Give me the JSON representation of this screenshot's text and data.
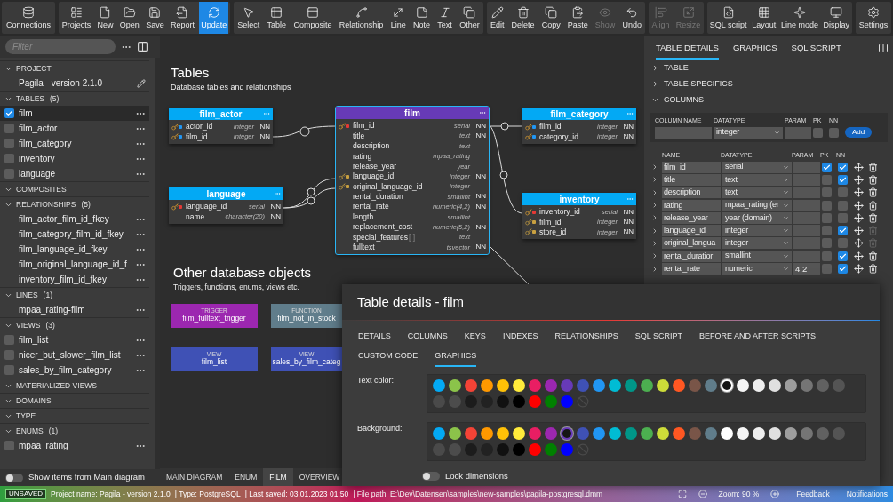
{
  "toolbar": [
    {
      "buttons": [
        {
          "label": "Connections",
          "selected": false,
          "disabled": false
        }
      ]
    },
    {
      "buttons": [
        {
          "label": "Projects",
          "selected": false,
          "disabled": false
        },
        {
          "label": "New",
          "selected": false,
          "disabled": false
        },
        {
          "label": "Open",
          "selected": false,
          "disabled": false
        },
        {
          "label": "Save",
          "selected": false,
          "disabled": false
        },
        {
          "label": "Report",
          "selected": false,
          "disabled": false
        },
        {
          "label": "Update",
          "selected": true,
          "disabled": false
        }
      ]
    },
    {
      "buttons": [
        {
          "label": "Select",
          "selected": false,
          "disabled": false
        },
        {
          "label": "Table",
          "selected": false,
          "disabled": false
        },
        {
          "label": "Composite",
          "selected": false,
          "disabled": false
        },
        {
          "label": "Relationship",
          "selected": false,
          "disabled": false
        },
        {
          "label": "Line",
          "selected": false,
          "disabled": false
        },
        {
          "label": "Note",
          "selected": false,
          "disabled": false
        },
        {
          "label": "Text",
          "selected": false,
          "disabled": false
        },
        {
          "label": "Other",
          "selected": false,
          "disabled": false
        }
      ]
    },
    {
      "buttons": [
        {
          "label": "Edit",
          "selected": false,
          "disabled": false
        },
        {
          "label": "Delete",
          "selected": false,
          "disabled": false
        },
        {
          "label": "Copy",
          "selected": false,
          "disabled": false
        },
        {
          "label": "Paste",
          "selected": false,
          "disabled": false
        },
        {
          "label": "Show",
          "selected": false,
          "disabled": true
        },
        {
          "label": "Undo",
          "selected": false,
          "disabled": false
        }
      ]
    },
    {
      "buttons": [
        {
          "label": "Align",
          "selected": false,
          "disabled": true
        },
        {
          "label": "Resize",
          "selected": false,
          "disabled": true
        }
      ]
    },
    {
      "buttons": [
        {
          "label": "SQL script",
          "selected": false,
          "disabled": false
        },
        {
          "label": "Layout",
          "selected": false,
          "disabled": false
        },
        {
          "label": "Line mode",
          "selected": false,
          "disabled": false
        },
        {
          "label": "Display",
          "selected": false,
          "disabled": false
        }
      ]
    },
    {
      "buttons": [
        {
          "label": "Settings",
          "selected": false,
          "disabled": false
        }
      ]
    }
  ],
  "sidebar": {
    "filter": {
      "placeholder": "Filter"
    },
    "sections": [
      {
        "title": "PROJECT",
        "expanded": true,
        "children": [
          {
            "label": "Pagila - version 2.1.0",
            "kind": "project",
            "selected": false
          }
        ]
      },
      {
        "title": "TABLES",
        "count": "(5)",
        "expanded": true,
        "children": [
          {
            "label": "film",
            "kind": "check",
            "checked": true,
            "selected": true
          },
          {
            "label": "film_actor",
            "kind": "check",
            "checked": false,
            "selected": false
          },
          {
            "label": "film_category",
            "kind": "check",
            "checked": false,
            "selected": false
          },
          {
            "label": "inventory",
            "kind": "check",
            "checked": false,
            "selected": false
          },
          {
            "label": "language",
            "kind": "check",
            "checked": false,
            "selected": false
          }
        ]
      },
      {
        "title": "COMPOSITES",
        "expanded": true
      },
      {
        "title": "RELATIONSHIPS",
        "count": "(5)",
        "expanded": true,
        "children": [
          {
            "label": "film_actor_film_id_fkey",
            "kind": "plain",
            "selected": false
          },
          {
            "label": "film_category_film_id_fkey",
            "kind": "plain",
            "selected": false
          },
          {
            "label": "film_language_id_fkey",
            "kind": "plain",
            "selected": false
          },
          {
            "label": "film_original_language_id_f",
            "kind": "plain",
            "selected": false
          },
          {
            "label": "inventory_film_id_fkey",
            "kind": "plain",
            "selected": false
          }
        ]
      },
      {
        "title": "LINES",
        "count": "(1)",
        "expanded": true,
        "children": [
          {
            "label": "mpaa_rating-film",
            "kind": "plain",
            "selected": false
          }
        ]
      },
      {
        "title": "VIEWS",
        "count": "(3)",
        "expanded": true,
        "children": [
          {
            "label": "film_list",
            "kind": "check",
            "checked": false,
            "selected": false
          },
          {
            "label": "nicer_but_slower_film_list",
            "kind": "check",
            "checked": false,
            "selected": false
          },
          {
            "label": "sales_by_film_category",
            "kind": "check",
            "checked": false,
            "selected": false
          }
        ]
      },
      {
        "title": "MATERIALIZED VIEWS",
        "expanded": true
      },
      {
        "title": "DOMAINS",
        "expanded": true
      },
      {
        "title": "TYPE",
        "expanded": true
      },
      {
        "title": "ENUMS",
        "count": "(1)",
        "expanded": true,
        "children": [
          {
            "label": "mpaa_rating",
            "kind": "check",
            "checked": false,
            "selected": false
          }
        ]
      }
    ],
    "toggle": {
      "label": "Show items from Main diagram",
      "on": false
    }
  },
  "canvas": {
    "tables_heading": {
      "title": "Tables",
      "subtitle": "Database tables and relationships"
    },
    "tables": [
      {
        "name": "film_actor",
        "color": "#03a9f4",
        "selected": false,
        "columns": [
          {
            "name": "actor_id",
            "type": "integer",
            "nn": "NN",
            "kind": "pkfk"
          },
          {
            "name": "film_id",
            "type": "integer",
            "nn": "NN",
            "kind": "pkfk"
          }
        ]
      },
      {
        "name": "film",
        "color": "#673ab7",
        "selected": true,
        "columns": [
          {
            "name": "film_id",
            "type": "serial",
            "nn": "NN",
            "kind": "pk"
          },
          {
            "name": "title",
            "type": "text",
            "nn": "NN",
            "kind": "plain"
          },
          {
            "name": "description",
            "type": "text",
            "kind": "plain"
          },
          {
            "name": "rating",
            "type": "mpaa_rating",
            "kind": "plain"
          },
          {
            "name": "release_year",
            "type": "year",
            "kind": "plain"
          },
          {
            "name": "language_id",
            "type": "integer",
            "nn": "NN",
            "kind": "fk"
          },
          {
            "name": "original_language_id",
            "type": "integer",
            "kind": "fk"
          },
          {
            "name": "rental_duration",
            "type": "smallint",
            "nn": "NN",
            "kind": "plain"
          },
          {
            "name": "rental_rate",
            "type": "numeric(4,2)",
            "nn": "NN",
            "kind": "plain"
          },
          {
            "name": "length",
            "type": "smallint",
            "kind": "plain"
          },
          {
            "name": "replacement_cost",
            "type": "numeric(5,2)",
            "nn": "NN",
            "kind": "plain"
          },
          {
            "name": "special_features",
            "suffix": "[ ]",
            "type": "text",
            "kind": "plain"
          },
          {
            "name": "fulltext",
            "type": "tsvector",
            "nn": "NN",
            "kind": "plain"
          }
        ]
      },
      {
        "name": "film_category",
        "color": "#03a9f4",
        "selected": false,
        "columns": [
          {
            "name": "film_id",
            "type": "integer",
            "nn": "NN",
            "kind": "pkfk"
          },
          {
            "name": "category_id",
            "type": "integer",
            "nn": "NN",
            "kind": "pkfk"
          }
        ]
      },
      {
        "name": "language",
        "color": "#03a9f4",
        "selected": false,
        "columns": [
          {
            "name": "language_id",
            "type": "serial",
            "nn": "NN",
            "kind": "pk"
          },
          {
            "name": "name",
            "type": "character(20)",
            "nn": "NN",
            "kind": "plain"
          }
        ]
      },
      {
        "name": "inventory",
        "color": "#03a9f4",
        "selected": false,
        "columns": [
          {
            "name": "inventory_id",
            "type": "serial",
            "nn": "NN",
            "kind": "pk"
          },
          {
            "name": "film_id",
            "type": "integer",
            "nn": "NN",
            "kind": "fk"
          },
          {
            "name": "store_id",
            "type": "integer",
            "nn": "NN",
            "kind": "fk"
          }
        ]
      }
    ],
    "others_heading": {
      "title": "Other database objects",
      "subtitle": "Triggers, functions, enums, views etc."
    },
    "objects": [
      {
        "kind": "TRIGGER",
        "name": "film_fulltext_trigger",
        "color": "#9c27b0"
      },
      {
        "kind": "FUNCTION",
        "name": "film_not_in_stock",
        "color": "#607d8b"
      },
      {
        "kind": "VIEW",
        "name": "film_list",
        "color": "#3f51b5"
      },
      {
        "kind": "VIEW",
        "name": "sales_by_film_categ",
        "color": "#3f51b5"
      }
    ],
    "tabs": [
      {
        "label": "MAIN DIAGRAM",
        "selected": false
      },
      {
        "label": "ENUM",
        "selected": false
      },
      {
        "label": "FILM",
        "selected": true
      },
      {
        "label": "OVERVIEW",
        "selected": false
      }
    ]
  },
  "right_panel": {
    "tabs": [
      {
        "label": "TABLE DETAILS",
        "selected": true
      },
      {
        "label": "GRAPHICS",
        "selected": false
      },
      {
        "label": "SQL SCRIPT",
        "selected": false
      }
    ],
    "sections": [
      {
        "title": "TABLE",
        "expanded": false
      },
      {
        "title": "TABLE SPECIFICS",
        "expanded": false
      },
      {
        "title": "COLUMNS",
        "expanded": true
      }
    ],
    "new_column": {
      "labels": [
        "COLUMN NAME",
        "DATATYPE",
        "PARAM",
        "PK",
        "NN"
      ],
      "datatype": "integer",
      "pk": false,
      "nn": false,
      "button": "Add"
    },
    "column_headers": [
      "NAME",
      "DATATYPE",
      "PARAM",
      "PK",
      "NN"
    ],
    "columns": [
      {
        "name": "film_id",
        "datatype": "serial",
        "pk": true,
        "nn": true,
        "removable": true
      },
      {
        "name": "title",
        "datatype": "text",
        "pk": false,
        "nn": true,
        "removable": true
      },
      {
        "name": "description",
        "datatype": "text",
        "pk": false,
        "nn": false,
        "removable": true
      },
      {
        "name": "rating",
        "datatype": "mpaa_rating (er",
        "pk": false,
        "nn": false,
        "removable": true
      },
      {
        "name": "release_year",
        "datatype": "year (domain)",
        "pk": false,
        "nn": false,
        "removable": true
      },
      {
        "name": "language_id",
        "datatype": "integer",
        "pk": false,
        "nn": true,
        "removable": false
      },
      {
        "name": "original_langua",
        "datatype": "integer",
        "pk": false,
        "nn": false,
        "removable": false
      },
      {
        "name": "rental_duratior",
        "datatype": "smallint",
        "pk": false,
        "nn": true,
        "removable": true
      },
      {
        "name": "rental_rate",
        "datatype": "numeric",
        "param": "4,2",
        "pk": false,
        "nn": true,
        "removable": true
      }
    ]
  },
  "dialog": {
    "title": "Table details - film",
    "tabs": [
      {
        "label": "DETAILS",
        "selected": false
      },
      {
        "label": "COLUMNS",
        "selected": false
      },
      {
        "label": "KEYS",
        "selected": false
      },
      {
        "label": "INDEXES",
        "selected": false
      },
      {
        "label": "RELATIONSHIPS",
        "selected": false
      },
      {
        "label": "SQL SCRIPT",
        "selected": false
      },
      {
        "label": "BEFORE AND AFTER SCRIPTS",
        "selected": false
      },
      {
        "label": "CUSTOM CODE",
        "selected": false
      },
      {
        "label": "GRAPHICS",
        "selected": true
      }
    ],
    "palettes": [
      {
        "label": "Text color:",
        "swatches": [
          {
            "kind": "color",
            "color": "#03a9f4",
            "selected": false
          },
          {
            "kind": "color",
            "color": "#8bc34a",
            "selected": false
          },
          {
            "kind": "color",
            "color": "#f44336",
            "selected": false
          },
          {
            "kind": "color",
            "color": "#ff9800",
            "selected": false
          },
          {
            "kind": "color",
            "color": "#ffc107",
            "selected": false
          },
          {
            "kind": "color",
            "color": "#ffeb3b",
            "selected": false
          },
          {
            "kind": "color",
            "color": "#e91e63",
            "selected": false
          },
          {
            "kind": "color",
            "color": "#9c27b0",
            "selected": false
          },
          {
            "kind": "color",
            "color": "#673ab7",
            "selected": false
          },
          {
            "kind": "color",
            "color": "#3f51b5",
            "selected": false
          },
          {
            "kind": "color",
            "color": "#2196f3",
            "selected": false
          },
          {
            "kind": "color",
            "color": "#00bcd4",
            "selected": false
          },
          {
            "kind": "color",
            "color": "#009688",
            "selected": false
          },
          {
            "kind": "color",
            "color": "#4caf50",
            "selected": false
          },
          {
            "kind": "color",
            "color": "#cddc39",
            "selected": false
          },
          {
            "kind": "color",
            "color": "#ff5722",
            "selected": false
          },
          {
            "kind": "color",
            "color": "#795548",
            "selected": false
          },
          {
            "kind": "color",
            "color": "#607d8b",
            "selected": false
          },
          {
            "kind": "color",
            "color": "#ffffff",
            "selected": true
          },
          {
            "kind": "color",
            "color": "#f5f5f5",
            "selected": false
          },
          {
            "kind": "color",
            "color": "#eeeeee",
            "selected": false
          },
          {
            "kind": "color",
            "color": "#e0e0e0",
            "selected": false
          },
          {
            "kind": "color",
            "color": "#9e9e9e",
            "selected": false
          },
          {
            "kind": "color",
            "color": "#757575",
            "selected": false
          },
          {
            "kind": "color",
            "color": "#616161",
            "selected": false
          },
          {
            "kind": "color",
            "color": "#545454",
            "selected": false
          },
          {
            "kind": "color",
            "color": "#4a4a4a",
            "selected": false
          },
          {
            "kind": "color",
            "color": "#4c4c4c",
            "selected": false
          },
          {
            "kind": "color",
            "color": "#1c1c1c",
            "selected": false
          },
          {
            "kind": "color",
            "color": "#222222",
            "selected": false
          },
          {
            "kind": "color",
            "color": "#111111",
            "selected": false
          },
          {
            "kind": "color",
            "color": "#000000",
            "selected": false
          },
          {
            "kind": "color",
            "color": "#ff0000",
            "selected": false
          },
          {
            "kind": "color",
            "color": "#008000",
            "selected": false
          },
          {
            "kind": "color",
            "color": "#0000ff",
            "selected": false
          },
          {
            "kind": "none",
            "selected": false
          }
        ]
      },
      {
        "label": "Background:",
        "swatches": [
          {
            "kind": "color",
            "color": "#03a9f4",
            "selected": false
          },
          {
            "kind": "color",
            "color": "#8bc34a",
            "selected": false
          },
          {
            "kind": "color",
            "color": "#f44336",
            "selected": false
          },
          {
            "kind": "color",
            "color": "#ff9800",
            "selected": false
          },
          {
            "kind": "color",
            "color": "#ffc107",
            "selected": false
          },
          {
            "kind": "color",
            "color": "#ffeb3b",
            "selected": false
          },
          {
            "kind": "color",
            "color": "#e91e63",
            "selected": false
          },
          {
            "kind": "color",
            "color": "#9c27b0",
            "selected": false
          },
          {
            "kind": "color",
            "color": "#673ab7",
            "selected": true
          },
          {
            "kind": "color",
            "color": "#3f51b5",
            "selected": false
          },
          {
            "kind": "color",
            "color": "#2196f3",
            "selected": false
          },
          {
            "kind": "color",
            "color": "#00bcd4",
            "selected": false
          },
          {
            "kind": "color",
            "color": "#009688",
            "selected": false
          },
          {
            "kind": "color",
            "color": "#4caf50",
            "selected": false
          },
          {
            "kind": "color",
            "color": "#cddc39",
            "selected": false
          },
          {
            "kind": "color",
            "color": "#ff5722",
            "selected": false
          },
          {
            "kind": "color",
            "color": "#795548",
            "selected": false
          },
          {
            "kind": "color",
            "color": "#607d8b",
            "selected": false
          },
          {
            "kind": "color",
            "color": "#ffffff",
            "selected": false
          },
          {
            "kind": "color",
            "color": "#f5f5f5",
            "selected": false
          },
          {
            "kind": "color",
            "color": "#eeeeee",
            "selected": false
          },
          {
            "kind": "color",
            "color": "#e0e0e0",
            "selected": false
          },
          {
            "kind": "color",
            "color": "#9e9e9e",
            "selected": false
          },
          {
            "kind": "color",
            "color": "#757575",
            "selected": false
          },
          {
            "kind": "color",
            "color": "#616161",
            "selected": false
          },
          {
            "kind": "color",
            "color": "#545454",
            "selected": false
          },
          {
            "kind": "color",
            "color": "#4a4a4a",
            "selected": false
          },
          {
            "kind": "color",
            "color": "#4c4c4c",
            "selected": false
          },
          {
            "kind": "color",
            "color": "#1c1c1c",
            "selected": false
          },
          {
            "kind": "color",
            "color": "#222222",
            "selected": false
          },
          {
            "kind": "color",
            "color": "#111111",
            "selected": false
          },
          {
            "kind": "color",
            "color": "#000000",
            "selected": false
          },
          {
            "kind": "color",
            "color": "#ff0000",
            "selected": false
          },
          {
            "kind": "color",
            "color": "#008000",
            "selected": false
          },
          {
            "kind": "color",
            "color": "#0000ff",
            "selected": false
          },
          {
            "kind": "none",
            "selected": false
          }
        ]
      }
    ],
    "lock": {
      "label": "Lock dimensions",
      "on": false
    }
  },
  "status_bar": {
    "badge": "UNSAVED",
    "items": [
      "Project name: Pagila - version 2.1.0",
      "| Type: PostgreSQL",
      "| Last saved: 03.01.2023 01:50",
      "| File path: E:\\Dev\\Datensen\\samples\\new-samples\\pagila-postgresql.dmm"
    ],
    "zoom": "Zoom: 90 %",
    "links": [
      "Feedback",
      "Notifications"
    ]
  }
}
